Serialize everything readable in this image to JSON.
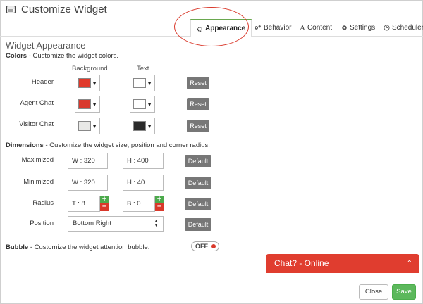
{
  "window": {
    "title": "Customize Widget"
  },
  "tabs": [
    {
      "label": "Appearance",
      "icon": "gear-outline-icon",
      "active": true
    },
    {
      "label": "Behavior",
      "icon": "gears-icon"
    },
    {
      "label": "Content",
      "icon": "font-icon"
    },
    {
      "label": "Settings",
      "icon": "gear-icon"
    },
    {
      "label": "Scheduler",
      "icon": "clock-icon"
    }
  ],
  "panel": {
    "title": "Widget Appearance",
    "colors": {
      "heading": "Colors",
      "description": " - Customize the widget colors.",
      "col_background": "Background",
      "col_text": "Text",
      "reset_label": "Reset",
      "rows": [
        {
          "label": "Header",
          "bg": "#e0392b",
          "text": "#ffffff"
        },
        {
          "label": "Agent Chat",
          "bg": "#d8392e",
          "text": "#ffffff"
        },
        {
          "label": "Visitor Chat",
          "bg": "#e8e8e6",
          "text": "#2a2a2a"
        }
      ]
    },
    "dimensions": {
      "heading": "Dimensions",
      "description": " - Customize the widget size, position and corner radius.",
      "default_label": "Default",
      "maximized": {
        "label": "Maximized",
        "w": "W : 320",
        "h": "H : 400"
      },
      "minimized": {
        "label": "Minimized",
        "w": "W : 320",
        "h": "H : 40"
      },
      "radius": {
        "label": "Radius",
        "t": "T : 8",
        "b": "B : 0"
      },
      "position": {
        "label": "Position",
        "value": "Bottom Right"
      }
    },
    "bubble": {
      "heading": "Bubble",
      "description": " - Customize the widget attention bubble.",
      "toggle_label": "OFF"
    }
  },
  "preview": {
    "chat_bar_text": "Chat? - Online"
  },
  "footer": {
    "close_label": "Close",
    "save_label": "Save"
  },
  "colors": {
    "accent_green": "#5cb85c",
    "accent_red": "#e03d2f",
    "tab_active_border": "#6aa84f"
  }
}
